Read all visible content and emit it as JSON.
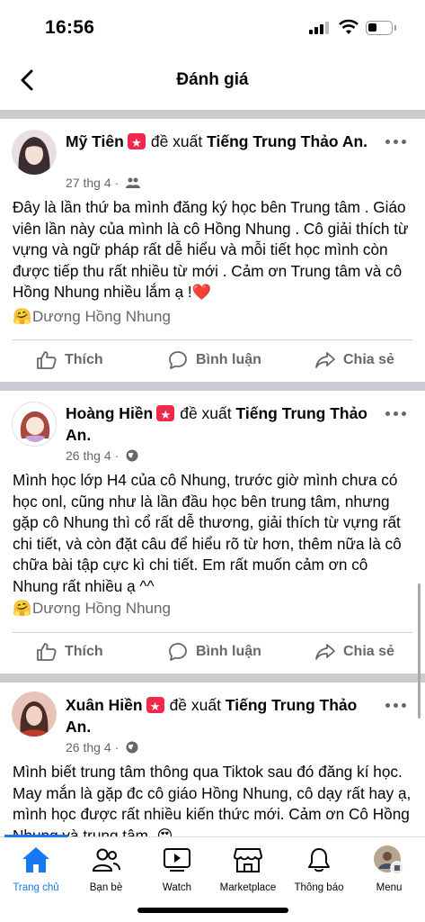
{
  "status": {
    "time": "16:56"
  },
  "header": {
    "title": "Đánh giá"
  },
  "posts": [
    {
      "author": "Mỹ Tiên",
      "verb": "đề xuất",
      "page": "Tiếng Trung Thảo An.",
      "date": "27 thg 4",
      "audience_icon": "friends-icon",
      "body": "Đây là lần thứ ba mình đăng ký học bên Trung tâm . Giáo viên lần này của mình là cô Hồng Nhung . Cô giải thích từ vựng và ngữ pháp rất dễ hiểu và mỗi tiết học mình còn được tiếp thu rất nhiều từ mới . Cảm ơn Trung tâm và cô Hồng Nhung nhiều lắm ạ !❤️",
      "tag": "Dương Hồng Nhung"
    },
    {
      "author": "Hoàng Hiền",
      "verb": "đề xuất",
      "page": "Tiếng Trung Thảo An.",
      "date": "26 thg 4",
      "audience_icon": "globe-icon",
      "body": "Mình học lớp H4 của cô Nhung, trước giờ mình chưa có học onl, cũng như là lần đầu học bên trung tâm, nhưng gặp cô Nhung thì cổ rất dễ thương, giải thích từ vựng rất chi tiết, và còn đặt câu để hiểu rõ từ hơn, thêm nữa là cô chữa bài tập cực kì chi tiết. Em rất muốn cảm ơn cô Nhung rất nhiều ạ ^^",
      "tag": "Dương Hồng Nhung"
    },
    {
      "author": "Xuân Hiền",
      "verb": "đề xuất",
      "page": "Tiếng Trung Thảo An.",
      "date": "26 thg 4",
      "audience_icon": "globe-icon",
      "body": "Mình biết trung tâm thông qua Tiktok sau đó đăng kí học. May mắn là gặp đc cô giáo Hồng Nhung, cô dạy rất hay ạ, mình học được rất nhiều kiến thức mới. Cảm ơn Cô Hồng Nhung và trung tâm. 😍"
    }
  ],
  "actions": {
    "like": "Thích",
    "comment": "Bình luận",
    "share": "Chia sẻ"
  },
  "nav": [
    {
      "label": "Trang chủ",
      "icon": "home-icon",
      "active": true
    },
    {
      "label": "Bạn bè",
      "icon": "friends-icon"
    },
    {
      "label": "Watch",
      "icon": "watch-icon"
    },
    {
      "label": "Marketplace",
      "icon": "marketplace-icon"
    },
    {
      "label": "Thông báo",
      "icon": "bell-icon"
    },
    {
      "label": "Menu",
      "icon": "menu-avatar-icon"
    }
  ],
  "colors": {
    "brand": "#1877f2",
    "secondary_text": "#65676b",
    "separator": "#c9ccd1",
    "recommend": "#f02849"
  }
}
